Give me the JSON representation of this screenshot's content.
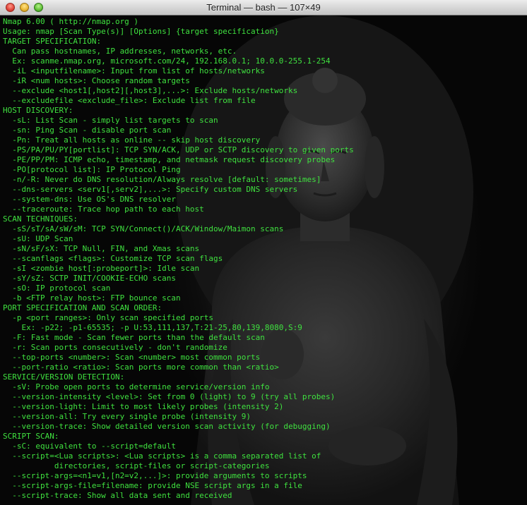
{
  "window": {
    "title": "Terminal — bash — 107×49",
    "colors": {
      "text": "#3fe13f",
      "background": "#0a0a0a"
    }
  },
  "terminal": {
    "lines": [
      "Nmap 6.00 ( http://nmap.org )",
      "Usage: nmap [Scan Type(s)] [Options] {target specification}",
      "TARGET SPECIFICATION:",
      "  Can pass hostnames, IP addresses, networks, etc.",
      "  Ex: scanme.nmap.org, microsoft.com/24, 192.168.0.1; 10.0.0-255.1-254",
      "  -iL <inputfilename>: Input from list of hosts/networks",
      "  -iR <num hosts>: Choose random targets",
      "  --exclude <host1[,host2][,host3],...>: Exclude hosts/networks",
      "  --excludefile <exclude_file>: Exclude list from file",
      "HOST DISCOVERY:",
      "  -sL: List Scan - simply list targets to scan",
      "  -sn: Ping Scan - disable port scan",
      "  -Pn: Treat all hosts as online -- skip host discovery",
      "  -PS/PA/PU/PY[portlist]: TCP SYN/ACK, UDP or SCTP discovery to given ports",
      "  -PE/PP/PM: ICMP echo, timestamp, and netmask request discovery probes",
      "  -PO[protocol list]: IP Protocol Ping",
      "  -n/-R: Never do DNS resolution/Always resolve [default: sometimes]",
      "  --dns-servers <serv1[,serv2],...>: Specify custom DNS servers",
      "  --system-dns: Use OS's DNS resolver",
      "  --traceroute: Trace hop path to each host",
      "SCAN TECHNIQUES:",
      "  -sS/sT/sA/sW/sM: TCP SYN/Connect()/ACK/Window/Maimon scans",
      "  -sU: UDP Scan",
      "  -sN/sF/sX: TCP Null, FIN, and Xmas scans",
      "  --scanflags <flags>: Customize TCP scan flags",
      "  -sI <zombie host[:probeport]>: Idle scan",
      "  -sY/sZ: SCTP INIT/COOKIE-ECHO scans",
      "  -sO: IP protocol scan",
      "  -b <FTP relay host>: FTP bounce scan",
      "PORT SPECIFICATION AND SCAN ORDER:",
      "  -p <port ranges>: Only scan specified ports",
      "    Ex: -p22; -p1-65535; -p U:53,111,137,T:21-25,80,139,8080,S:9",
      "  -F: Fast mode - Scan fewer ports than the default scan",
      "  -r: Scan ports consecutively - don't randomize",
      "  --top-ports <number>: Scan <number> most common ports",
      "  --port-ratio <ratio>: Scan ports more common than <ratio>",
      "SERVICE/VERSION DETECTION:",
      "  -sV: Probe open ports to determine service/version info",
      "  --version-intensity <level>: Set from 0 (light) to 9 (try all probes)",
      "  --version-light: Limit to most likely probes (intensity 2)",
      "  --version-all: Try every single probe (intensity 9)",
      "  --version-trace: Show detailed version scan activity (for debugging)",
      "SCRIPT SCAN:",
      "  -sC: equivalent to --script=default",
      "  --script=<Lua scripts>: <Lua scripts> is a comma separated list of",
      "           directories, script-files or script-categories",
      "  --script-args=<n1=v1,[n2=v2,...]>: provide arguments to scripts",
      "  --script-args-file=filename: provide NSE script args in a file",
      "  --script-trace: Show all data sent and received"
    ]
  }
}
